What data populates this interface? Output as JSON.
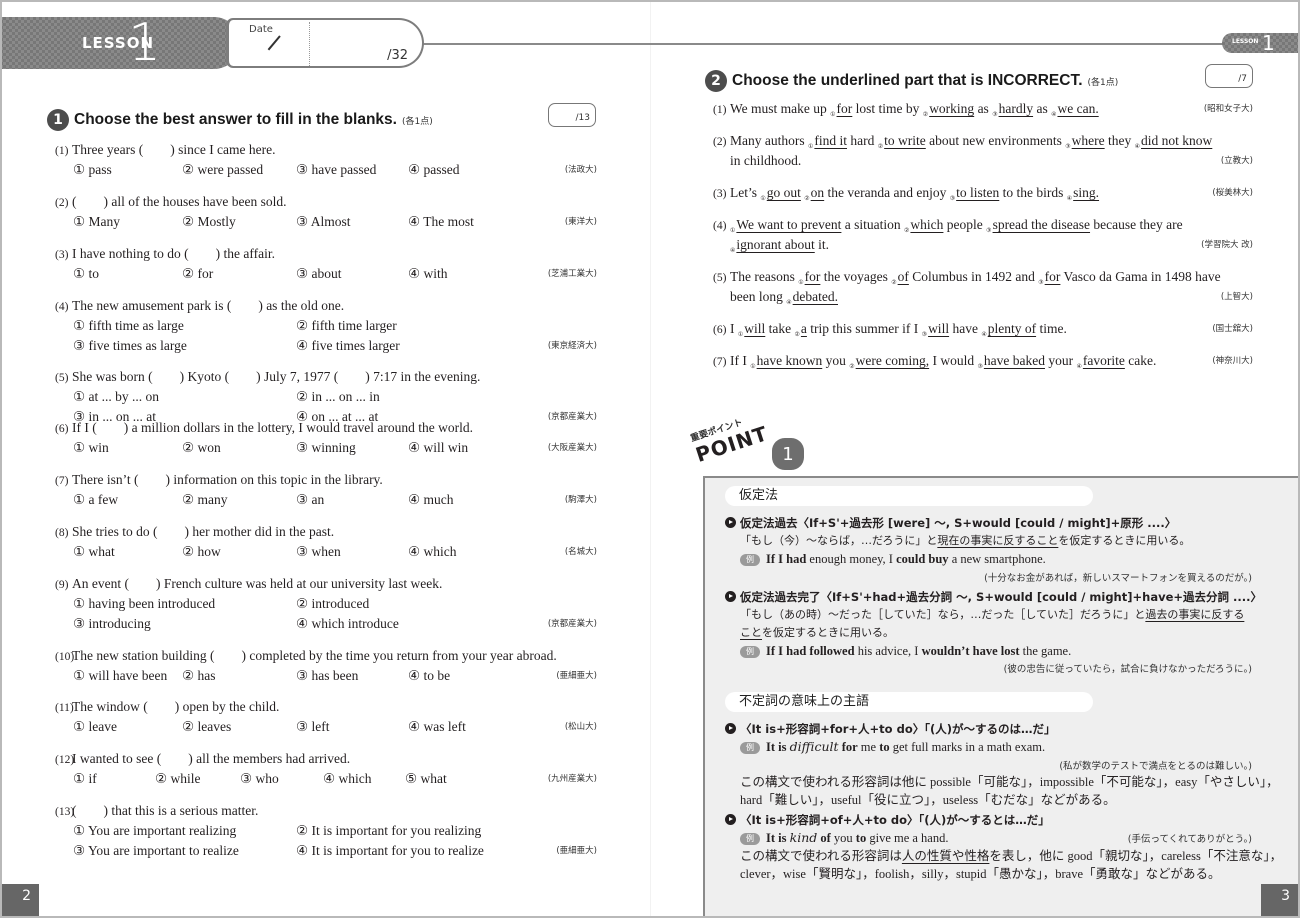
{
  "header": {
    "lesson_word": "LESSON",
    "lesson_number": "1",
    "date_label": "Date",
    "total_score": "/32",
    "right_lesson_word": "LESSON",
    "right_lesson_number": "1"
  },
  "section1": {
    "number": "1",
    "title": "Choose the best answer to fill in the blanks.",
    "points": "(各1点)",
    "score": "/13",
    "questions": [
      {
        "no": "(1)",
        "text": "Three years (　　) since I came here.",
        "options": [
          "① pass",
          "② were passed",
          "③ have passed",
          "④ passed"
        ],
        "source": "(法政大)"
      },
      {
        "no": "(2)",
        "text": "(　　) all of the houses have been sold.",
        "options": [
          "① Many",
          "② Mostly",
          "③ Almost",
          "④ The most"
        ],
        "source": "(東洋大)"
      },
      {
        "no": "(3)",
        "text": "I have nothing to do (　　) the affair.",
        "options": [
          "① to",
          "② for",
          "③ about",
          "④ with"
        ],
        "source": "(芝浦工業大)"
      },
      {
        "no": "(4)",
        "text": "The new amusement park is (　　) as the old one.",
        "options": [
          "① fifth time as large",
          "② fifth time larger",
          "③ five times as large",
          "④ five times larger"
        ],
        "source": "(東京経済大)"
      },
      {
        "no": "(5)",
        "text": "She was born (　　) Kyoto (　　) July 7, 1977 (　　) 7:17 in the evening.",
        "options": [
          "① at ... by ... on",
          "② in ... on ... in",
          "③ in ... on ... at",
          "④ on ... at ... at"
        ],
        "source": "(京都産業大)"
      },
      {
        "no": "(6)",
        "text": "If I (　　) a million dollars in the lottery, I would travel around the world.",
        "options": [
          "① win",
          "② won",
          "③ winning",
          "④ will win"
        ],
        "source": "(大阪産業大)"
      },
      {
        "no": "(7)",
        "text": "There isn’t (　　) information on this topic in the library.",
        "options": [
          "① a few",
          "② many",
          "③ an",
          "④ much"
        ],
        "source": "(駒澤大)"
      },
      {
        "no": "(8)",
        "text": "She tries to do (　　) her mother did in the past.",
        "options": [
          "① what",
          "② how",
          "③ when",
          "④ which"
        ],
        "source": "(名城大)"
      },
      {
        "no": "(9)",
        "text": "An event (　　) French culture was held at our university last week.",
        "options": [
          "① having been introduced",
          "② introduced",
          "③ introducing",
          "④ which introduce"
        ],
        "source": "(京都産業大)"
      },
      {
        "no": "(10)",
        "text": "The new station building (　　) completed by the time you return from your year abroad.",
        "options": [
          "① will have been",
          "② has",
          "③ has been",
          "④ to be"
        ],
        "source": "(亜細亜大)"
      },
      {
        "no": "(11)",
        "text": "The window (　　) open by the child.",
        "options": [
          "① leave",
          "② leaves",
          "③ left",
          "④ was left"
        ],
        "source": "(松山大)"
      },
      {
        "no": "(12)",
        "text": "I wanted to see (　　) all the members had arrived.",
        "options": [
          "① if",
          "② while",
          "③ who",
          "④ which",
          "⑤ what"
        ],
        "source": "(九州産業大)"
      },
      {
        "no": "(13)",
        "text": "(　　) that this is a serious matter.",
        "options": [
          "① You are important realizing",
          "② It is important for you realizing",
          "③ You are important to realize",
          "④ It is important for you to realize"
        ],
        "source": "(亜細亜大)"
      }
    ]
  },
  "section2": {
    "number": "2",
    "title": "Choose the underlined part that is INCORRECT.",
    "points": "(各1点)",
    "score": "/7",
    "questions": [
      {
        "no": "(1)",
        "parts": [
          "We must make up ",
          {
            "m": "①",
            "u": "for"
          },
          " lost time by ",
          {
            "m": "②",
            "u": "working"
          },
          " as ",
          {
            "m": "③",
            "u": "hardly"
          },
          " as ",
          {
            "m": "④",
            "u": "we can."
          }
        ],
        "source": "(昭和女子大)"
      },
      {
        "no": "(2)",
        "parts": [
          "Many authors ",
          {
            "m": "①",
            "u": "find it"
          },
          " hard ",
          {
            "m": "②",
            "u": "to write"
          },
          " about new environments ",
          {
            "m": "③",
            "u": "where"
          },
          " they ",
          {
            "m": "④",
            "u": "did not know"
          }
        ],
        "line2": "in childhood.",
        "source": "(立教大)"
      },
      {
        "no": "(3)",
        "parts": [
          "Let’s ",
          {
            "m": "①",
            "u": "go out"
          },
          " ",
          {
            "m": "②",
            "u": "on"
          },
          " the veranda and enjoy ",
          {
            "m": "③",
            "u": "to listen"
          },
          " to the birds ",
          {
            "m": "④",
            "u": "sing."
          }
        ],
        "source": "(桜美林大)"
      },
      {
        "no": "(4)",
        "parts": [
          {
            "m": "①",
            "u": "We want to prevent"
          },
          " a situation ",
          {
            "m": "②",
            "u": "which"
          },
          " people ",
          {
            "m": "③",
            "u": "spread the disease"
          },
          " because they are"
        ],
        "line2_parts": [
          {
            "m": "④",
            "u": "ignorant about"
          },
          " it."
        ],
        "source": "(学習院大 改)"
      },
      {
        "no": "(5)",
        "parts": [
          "The reasons ",
          {
            "m": "①",
            "u": "for"
          },
          " the voyages ",
          {
            "m": "②",
            "u": "of"
          },
          " Columbus in 1492 and ",
          {
            "m": "③",
            "u": "for"
          },
          " Vasco da Gama in 1498 have"
        ],
        "line2_parts": [
          "been long ",
          {
            "m": "④",
            "u": "debated."
          }
        ],
        "source": "(上智大)"
      },
      {
        "no": "(6)",
        "parts": [
          "I ",
          {
            "m": "①",
            "u": "will"
          },
          " take ",
          {
            "m": "②",
            "u": "a"
          },
          " trip this summer if I ",
          {
            "m": "③",
            "u": "will"
          },
          " have ",
          {
            "m": "④",
            "u": "plenty of"
          },
          " time."
        ],
        "source": "(国士舘大)"
      },
      {
        "no": "(7)",
        "parts": [
          "If I ",
          {
            "m": "①",
            "u": "have known"
          },
          " you ",
          {
            "m": "②",
            "u": "were coming,"
          },
          " I would ",
          {
            "m": "③",
            "u": "have baked"
          },
          " your ",
          {
            "m": "④",
            "u": "favorite"
          },
          " cake."
        ],
        "source": "(神奈川大)"
      }
    ]
  },
  "point": {
    "label_jp": "重要ポイント",
    "label_en": "POINT",
    "number": "1",
    "topic1": {
      "title": "仮定法",
      "rule1": "仮定法過去〈If+S'+過去形 [were] ～, S+would [could / might]+原形 ....〉",
      "rule1_expl_pre": "「もし（今）～ならば，…だろうに」と",
      "rule1_expl_u": "現在の事実に反すること",
      "rule1_expl_post": "を仮定するときに用いる。",
      "ex_badge": "例",
      "ex1": [
        {
          "b": "If I had"
        },
        " enough money, I ",
        {
          "b": "could buy"
        },
        " a new smartphone."
      ],
      "ex1_tr": "(十分なお金があれば，新しいスマートフォンを買えるのだが。)",
      "rule2": "仮定法過去完了〈If+S'+had+過去分詞 ～, S+would [could / might]+have+過去分詞 ....〉",
      "rule2_expl_pre": "「もし（あの時）～だった［していた］なら，…だった［していた］だろうに」と",
      "rule2_expl_u1": "過去の事実に反する",
      "rule2_expl_u2": "こと",
      "rule2_expl_post": "を仮定するときに用いる。",
      "ex2": [
        {
          "b": "If I had followed"
        },
        " his advice, I ",
        {
          "b": "wouldn’t have lost"
        },
        " the game."
      ],
      "ex2_tr": "(彼の忠告に従っていたら，試合に負けなかっただろうに。)"
    },
    "topic2": {
      "title": "不定詞の意味上の主語",
      "rule1": "〈It is+形容詞+for+人+to do〉「(人)が～するのは…だ」",
      "ex1": [
        {
          "b": "It is "
        },
        {
          "i": "difficult"
        },
        {
          "b": " for"
        },
        " me ",
        {
          "b": "to"
        },
        " get full marks in a math exam."
      ],
      "ex1_tr": "(私が数学のテストで満点をとるのは難しい。)",
      "note1_l1": "この構文で使われる形容詞は他に possible「可能な」，impossible「不可能な」，easy「やさしい」，",
      "note1_l2": "hard「難しい」，useful「役に立つ」，useless「むだな」などがある。",
      "rule2": "〈It is+形容詞+of+人+to do〉「(人)が～するとは…だ」",
      "ex2": [
        {
          "b": "It is "
        },
        {
          "i": "kind"
        },
        {
          "b": " of"
        },
        " you ",
        {
          "b": "to"
        },
        " give me a hand."
      ],
      "ex2_tr": "(手伝ってくれてありがとう。)",
      "note2_pre": "この構文で使われる形容詞は",
      "note2_u": "人の性質や性格",
      "note2_post": "を表し，他に good「親切な」，careless「不注意な」，",
      "note2_l2": "clever，wise「賢明な」，foolish，silly，stupid「愚かな」，brave「勇敢な」などがある。"
    }
  },
  "footer": {
    "left_page": "2",
    "right_page": "3"
  }
}
